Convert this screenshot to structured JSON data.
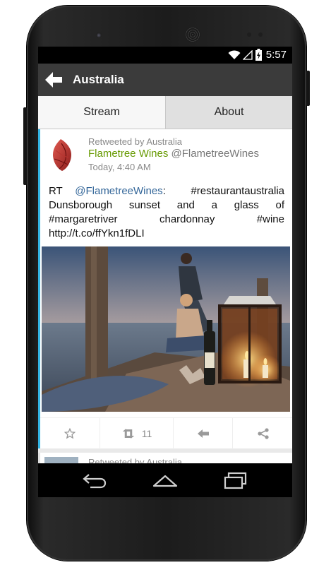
{
  "status": {
    "time": "5:57"
  },
  "action_bar": {
    "title": "Australia",
    "back_icon": "back-arrow-icon"
  },
  "tabs": [
    {
      "label": "Stream",
      "selected": true
    },
    {
      "label": "About",
      "selected": false
    }
  ],
  "tweets": [
    {
      "retweeted_by": "Retweeted by Australia",
      "author": "Flametree Wines",
      "handle": "@FlametreeWines",
      "timestamp": "Today, 4:40 AM",
      "text": {
        "prefix": "RT",
        "mention": "@FlametreeWines",
        "after_mention": ":  #restaurantaustralia",
        "line2": "Dunsborough sunset and a glass of",
        "line3": "#margaretriver chardonnay #wine",
        "line4": "http://t.co/ffYkn1fDLI"
      },
      "retweet_count": "11",
      "accent_color": "#33b5e5"
    },
    {
      "retweeted_by": "Retweeted by Australia"
    }
  ],
  "colors": {
    "author": "#669900",
    "mention": "#336699",
    "accent": "#33b5e5",
    "action_bar": "#3b3b3b"
  }
}
